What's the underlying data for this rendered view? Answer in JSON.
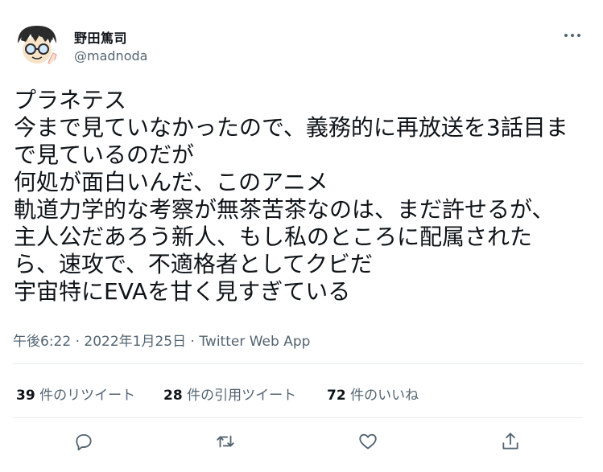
{
  "author": {
    "display_name": "野田篤司",
    "handle": "@madnoda"
  },
  "tweet": {
    "lines": [
      "プラネテス",
      "今まで見ていなかったので、義務的に再放送を3話目ま",
      "で見ているのだが",
      "何処が面白いんだ、このアニメ",
      "軌道力学的な考察が無茶苦茶なのは、まだ許せるが、",
      "主人公だあろう新人、もし私のところに配属された",
      "ら、速攻で、不適格者としてクビだ",
      "宇宙特にEVAを甘く見すぎている"
    ]
  },
  "meta": {
    "time": "午後6:22",
    "separator": " · ",
    "date": "2022年1月25日",
    "source": "Twitter Web App"
  },
  "stats": {
    "retweets": {
      "count": "39",
      "label": "件のリツイート"
    },
    "quotes": {
      "count": "28",
      "label": "件の引用ツイート"
    },
    "likes": {
      "count": "72",
      "label": "件のいいね"
    }
  },
  "icons": {
    "more": "more-icon",
    "reply": "reply-icon",
    "retweet": "retweet-icon",
    "like": "like-icon",
    "share": "share-icon"
  },
  "colors": {
    "text": "#0f1419",
    "secondary": "#536471",
    "divider": "#e6ecf0"
  }
}
